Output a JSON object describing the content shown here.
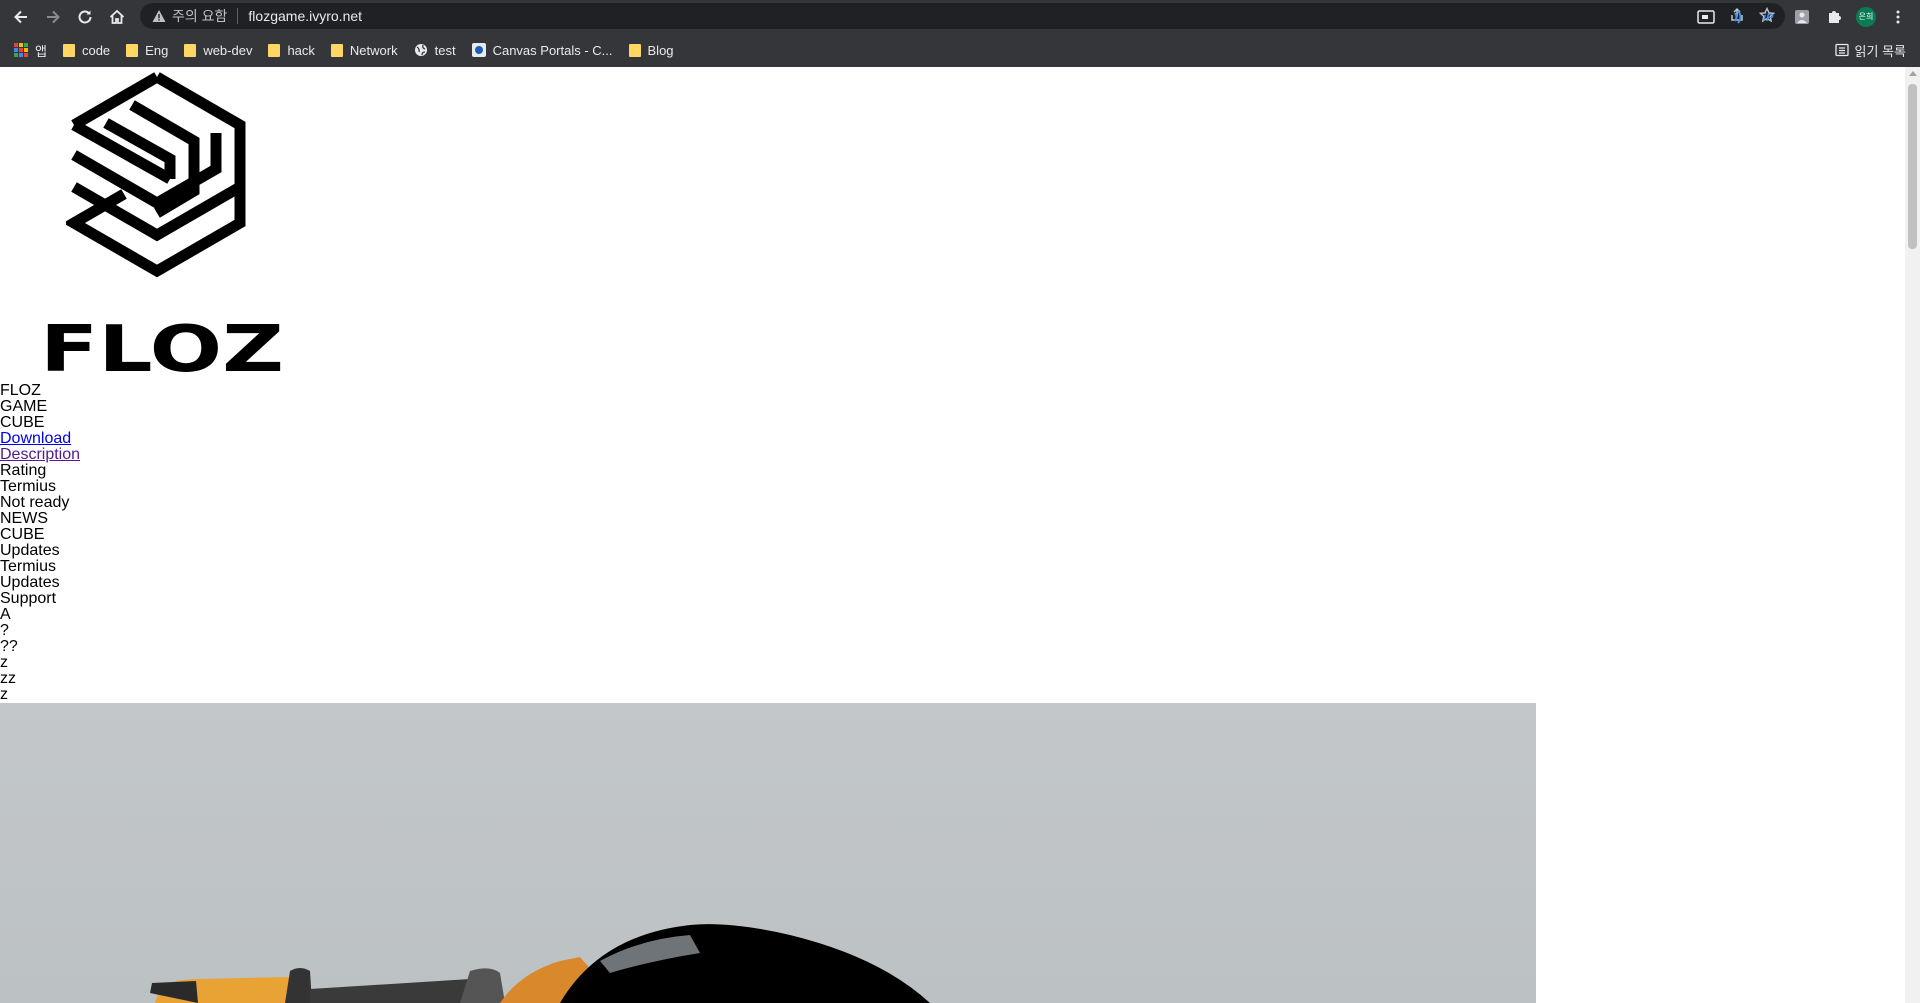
{
  "browser": {
    "security_warning": "주의 요함",
    "url": "flozgame.ivyro.net",
    "profile_label": "은희",
    "reading_list_label": "읽기 목록"
  },
  "bookmarks": [
    {
      "label": "앱",
      "icon": "apps-grid-icon"
    },
    {
      "label": "code",
      "icon": "folder-icon"
    },
    {
      "label": "Eng",
      "icon": "folder-icon"
    },
    {
      "label": "web-dev",
      "icon": "folder-icon"
    },
    {
      "label": "hack",
      "icon": "folder-icon"
    },
    {
      "label": "Network",
      "icon": "folder-icon"
    },
    {
      "label": "test",
      "icon": "globe-icon"
    },
    {
      "label": "Canvas Portals - C...",
      "icon": "canvas-icon"
    },
    {
      "label": "Blog",
      "icon": "folder-icon"
    }
  ],
  "page": {
    "logo_text": "FLOZ",
    "items": [
      {
        "text": "FLOZ",
        "link": false
      },
      {
        "text": "GAME",
        "link": false
      },
      {
        "text": "CUBE",
        "link": false
      },
      {
        "text": "Download",
        "link": true,
        "visited": false
      },
      {
        "text": "Description",
        "link": true,
        "visited": true
      },
      {
        "text": "Rating",
        "link": false
      },
      {
        "text": "Termius",
        "link": false
      },
      {
        "text": "Not ready",
        "link": false
      },
      {
        "text": "NEWS",
        "link": false
      },
      {
        "text": "CUBE",
        "link": false
      },
      {
        "text": "Updates",
        "link": false
      },
      {
        "text": "Termius",
        "link": false
      },
      {
        "text": "Updates",
        "link": false
      },
      {
        "text": "Support",
        "link": false
      },
      {
        "text": "A",
        "link": false
      },
      {
        "text": "?",
        "link": false
      },
      {
        "text": "??",
        "link": false
      },
      {
        "text": "z",
        "link": false
      },
      {
        "text": "zz",
        "link": false
      },
      {
        "text": "z",
        "link": false
      }
    ]
  },
  "colors": {
    "chrome_bg": "#35363a",
    "omnibox_bg": "#202124",
    "link": "#0000ee",
    "visited_link": "#551a8b",
    "folder": "#fdd663"
  }
}
